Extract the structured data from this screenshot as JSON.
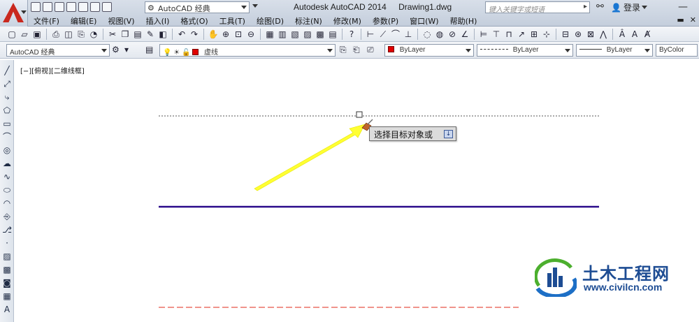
{
  "app": {
    "workspace": "AutoCAD 经典",
    "title_app": "Autodesk AutoCAD 2014",
    "title_file": "Drawing1.dwg",
    "search_placeholder": "键入关键字或短语",
    "login_label": "登录"
  },
  "menu": [
    "文件(F)",
    "编辑(E)",
    "视图(V)",
    "插入(I)",
    "格式(O)",
    "工具(T)",
    "绘图(D)",
    "标注(N)",
    "修改(M)",
    "参数(P)",
    "窗口(W)",
    "帮助(H)"
  ],
  "toolbar2": {
    "workspace_combo": "AutoCAD 经典",
    "layer_combo": "虚线",
    "color_combo": "ByLayer",
    "linetype_combo": "ByLayer",
    "lineweight_combo": "ByLayer",
    "plotstyle_combo": "ByColor"
  },
  "viewport": {
    "label": "[−][俯视][二维线框]"
  },
  "tooltip": {
    "text": "选择目标对象或"
  },
  "watermark": {
    "title": "土木工程网",
    "url": "www.civilcn.com"
  },
  "colors": {
    "solid_line": "#2a0a8a",
    "dashed_line_red": "#e02a1a",
    "arrow": "#ffff33",
    "brand": "#1d4c93"
  }
}
